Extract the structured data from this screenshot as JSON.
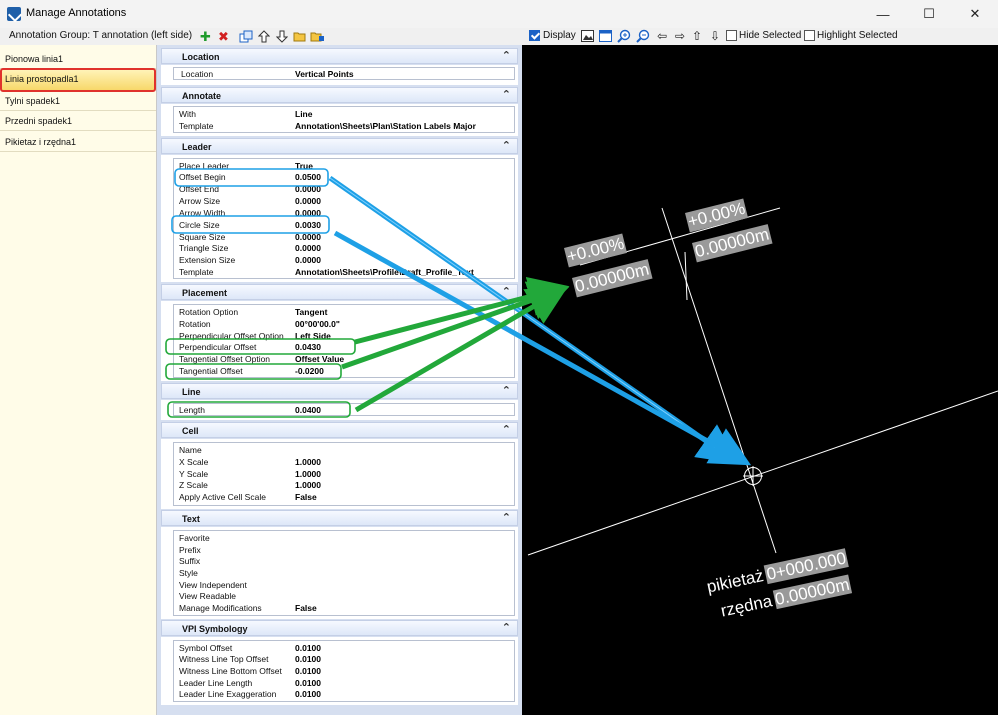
{
  "window": {
    "title": "Manage Annotations",
    "minimize_glyph": "—",
    "maximize_glyph": "☐",
    "close_glyph": "✕"
  },
  "toolbar": {
    "group_label": "Annotation Group: T annotation (left side)",
    "display_label": "Display",
    "display_checked": true,
    "hide_selected_label": "Hide Selected",
    "highlight_selected_label": "Highlight Selected"
  },
  "annotations": [
    {
      "label": "Pionowa linia1"
    },
    {
      "label": "Linia prostopadla1"
    },
    {
      "label": "Tylni spadek1"
    },
    {
      "label": "Przedni spadek1"
    },
    {
      "label": "Pikietaz i rzędna1"
    }
  ],
  "sections": {
    "location": {
      "title": "Location",
      "rows": [
        {
          "name": "Location",
          "value": "Vertical Points"
        }
      ]
    },
    "annotate": {
      "title": "Annotate",
      "rows": [
        {
          "name": "With",
          "value": "Line"
        },
        {
          "name": "Template",
          "value": "Annotation\\Sheets\\Plan\\Station Labels Major"
        }
      ]
    },
    "leader": {
      "title": "Leader",
      "rows": [
        {
          "name": "Place Leader",
          "value": "True"
        },
        {
          "name": "Offset Begin",
          "value": "0.0500"
        },
        {
          "name": "Offset End",
          "value": "0.0000"
        },
        {
          "name": "Arrow Size",
          "value": "0.0000"
        },
        {
          "name": "Arrow Width",
          "value": "0.0000"
        },
        {
          "name": "Circle Size",
          "value": "0.0030"
        },
        {
          "name": "Square Size",
          "value": "0.0000"
        },
        {
          "name": "Triangle Size",
          "value": "0.0000"
        },
        {
          "name": "Extension Size",
          "value": "0.0000"
        },
        {
          "name": "Template",
          "value": "Annotation\\Sheets\\Profile\\Draft_Profile_Text"
        }
      ]
    },
    "placement": {
      "title": "Placement",
      "rows": [
        {
          "name": "Rotation Option",
          "value": "Tangent"
        },
        {
          "name": "Rotation",
          "value": "00°00'00.0\""
        },
        {
          "name": "Perpendicular Offset Option",
          "value": "Left Side"
        },
        {
          "name": "Perpendicular Offset",
          "value": "0.0430"
        },
        {
          "name": "Tangential Offset Option",
          "value": "Offset Value"
        },
        {
          "name": "Tangential Offset",
          "value": "-0.0200"
        }
      ]
    },
    "line": {
      "title": "Line",
      "rows": [
        {
          "name": "Length",
          "value": "0.0400"
        }
      ]
    },
    "cell": {
      "title": "Cell",
      "rows": [
        {
          "name": "Name",
          "value": ""
        },
        {
          "name": "X Scale",
          "value": "1.0000"
        },
        {
          "name": "Y Scale",
          "value": "1.0000"
        },
        {
          "name": "Z Scale",
          "value": "1.0000"
        },
        {
          "name": "Apply Active Cell Scale",
          "value": "False"
        }
      ]
    },
    "text": {
      "title": "Text",
      "rows": [
        {
          "name": "Favorite",
          "value": ""
        },
        {
          "name": "Prefix",
          "value": ""
        },
        {
          "name": "Suffix",
          "value": ""
        },
        {
          "name": "Style",
          "value": ""
        },
        {
          "name": "View Independent",
          "value": ""
        },
        {
          "name": "View Readable",
          "value": ""
        },
        {
          "name": "Manage Modifications",
          "value": "False"
        }
      ]
    },
    "vpi": {
      "title": "VPI Symbology",
      "rows": [
        {
          "name": "Symbol Offset",
          "value": "0.0100"
        },
        {
          "name": "Witness Line Top Offset",
          "value": "0.0100"
        },
        {
          "name": "Witness Line Bottom Offset",
          "value": "0.0100"
        },
        {
          "name": "Leader Line Length",
          "value": "0.0100"
        },
        {
          "name": "Leader Line Exaggeration",
          "value": "0.0100"
        }
      ]
    }
  },
  "viewport": {
    "label_left_top": "+0.00%",
    "label_left_bottom": "0.00000m",
    "label_right_top": "+0.00%",
    "label_right_bottom": "0.00000m",
    "station_prefix": "pikietaż",
    "station_value": "0+000.000",
    "elevation_prefix": "rzędna",
    "elevation_value": "0.00000m"
  },
  "icons": {
    "add": "plus-icon",
    "delete": "delete-icon",
    "zoom_in": "zoom-in-icon",
    "zoom_out": "zoom-out-icon"
  },
  "colors": {
    "selection_outline": "#e0322c",
    "blue_callout": "#1ea0e6",
    "green_callout": "#22a83a"
  }
}
